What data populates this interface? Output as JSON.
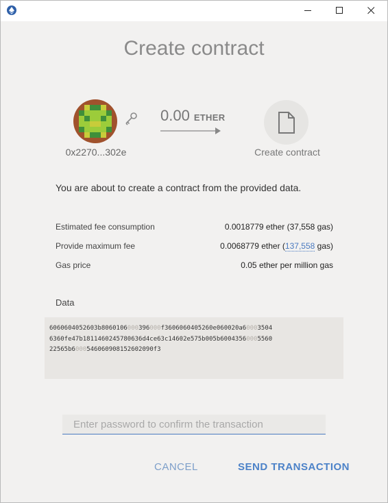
{
  "window": {
    "minimize_symbol": "─",
    "maximize_symbol": "☐",
    "close_symbol": "✕"
  },
  "header": {
    "title": "Create contract"
  },
  "from": {
    "address": "0x2270...302e"
  },
  "amount": {
    "value": "0.00",
    "unit": "ETHER"
  },
  "to": {
    "label": "Create contract"
  },
  "intro": "You are about to create a contract from the provided data.",
  "fees": [
    {
      "label": "Estimated fee consumption",
      "value": "0.0018779 ether (37,558 gas)"
    },
    {
      "label": "Provide maximum fee",
      "value_prefix": "0.0068779 ether (",
      "value_link": "137,558",
      "value_suffix": " gas)"
    },
    {
      "label": "Gas price",
      "value": "0.05 ether per million gas"
    }
  ],
  "data_section": {
    "label": "Data",
    "lines": [
      "6060604052603b8060106000396000f3606060405260e060020a60003504",
      "6360fe47b1811460245780636d4ce63c14602e575b005b60043560005560",
      "22565b6000546060908152602090f3"
    ]
  },
  "password": {
    "placeholder": "Enter password to confirm the transaction",
    "value": ""
  },
  "actions": {
    "cancel_label": "CANCEL",
    "send_label": "SEND TRANSACTION"
  },
  "colors": {
    "accent": "#4c82c8",
    "background": "#f2f1f0",
    "data_box": "#e8e6e3"
  },
  "icons": {
    "app": "ethereum-icon",
    "key": "key-icon",
    "contract": "document-icon",
    "arrow": "arrow-right-icon"
  }
}
